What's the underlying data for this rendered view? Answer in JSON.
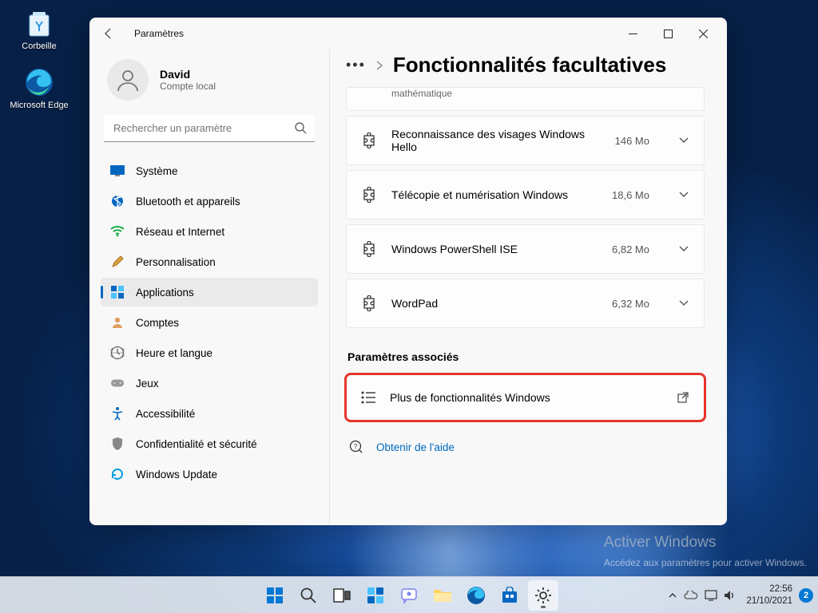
{
  "desktop": {
    "icons": [
      {
        "name": "Corbeille"
      },
      {
        "name": "Microsoft Edge"
      }
    ]
  },
  "window": {
    "title": "Paramètres",
    "user": {
      "name": "David",
      "type": "Compte local"
    },
    "search_placeholder": "Rechercher un paramètre",
    "nav": [
      {
        "label": "Système"
      },
      {
        "label": "Bluetooth et appareils"
      },
      {
        "label": "Réseau et Internet"
      },
      {
        "label": "Personnalisation"
      },
      {
        "label": "Applications"
      },
      {
        "label": "Comptes"
      },
      {
        "label": "Heure et langue"
      },
      {
        "label": "Jeux"
      },
      {
        "label": "Accessibilité"
      },
      {
        "label": "Confidentialité et sécurité"
      },
      {
        "label": "Windows Update"
      }
    ],
    "breadcrumb_title": "Fonctionnalités facultatives",
    "cut_feature_sub": "mathématique",
    "features": [
      {
        "label": "Reconnaissance des visages Windows Hello",
        "size": "146 Mo"
      },
      {
        "label": "Télécopie et numérisation Windows",
        "size": "18,6 Mo"
      },
      {
        "label": "Windows PowerShell ISE",
        "size": "6,82 Mo"
      },
      {
        "label": "WordPad",
        "size": "6,32 Mo"
      }
    ],
    "related_title": "Paramètres associés",
    "related_link": "Plus de fonctionnalités Windows",
    "help_link": "Obtenir de l'aide"
  },
  "watermark": {
    "title": "Activer Windows",
    "sub": "Accédez aux paramètres pour activer Windows."
  },
  "taskbar": {
    "time": "22:56",
    "date": "21/10/2021",
    "badge": "2"
  }
}
